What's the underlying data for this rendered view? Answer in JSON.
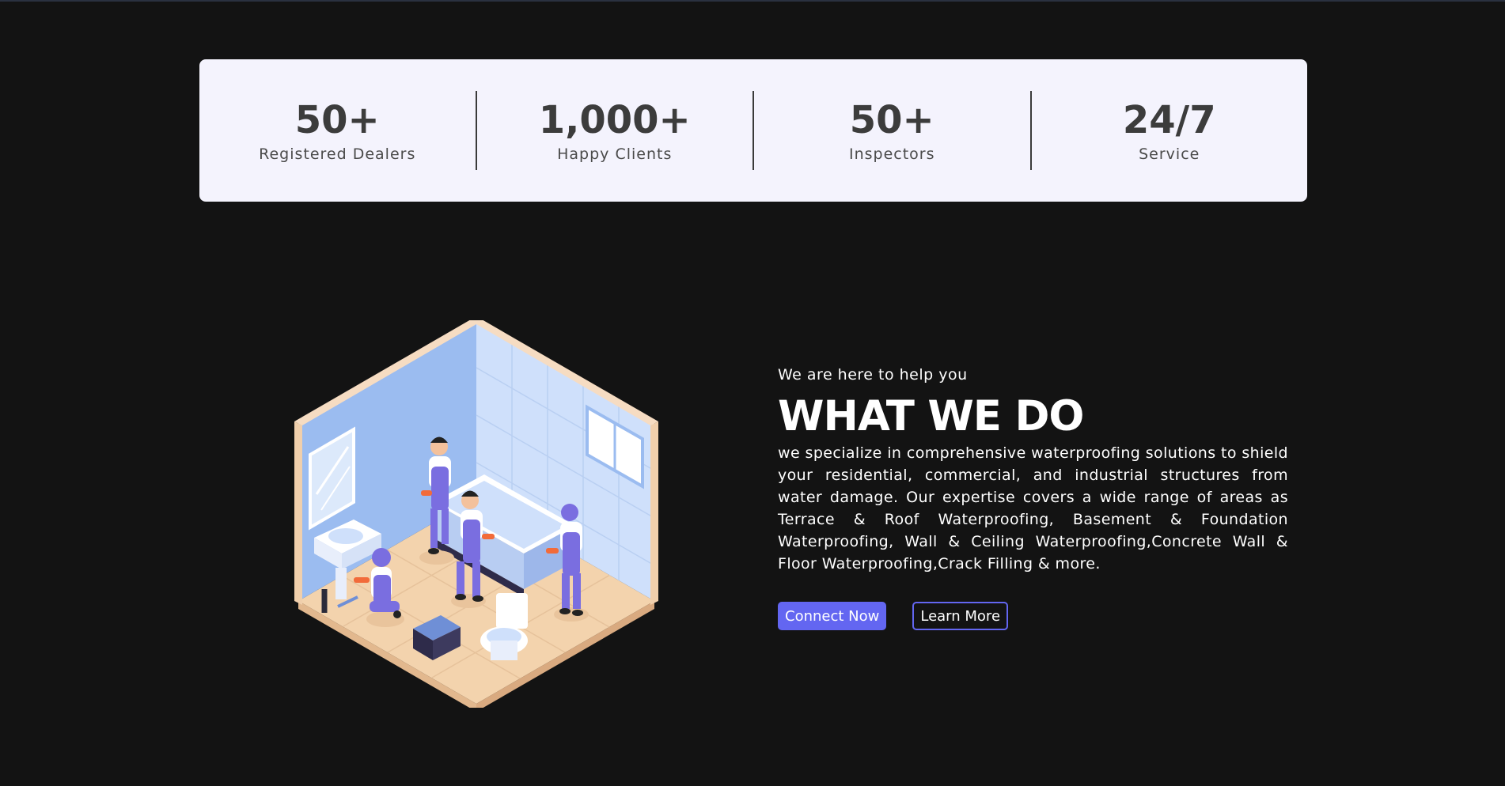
{
  "stats": [
    {
      "value": "50+",
      "label": "Registered Dealers"
    },
    {
      "value": "1,000+",
      "label": "Happy Clients"
    },
    {
      "value": "50+",
      "label": "Inspectors"
    },
    {
      "value": "24/7",
      "label": "Service"
    }
  ],
  "about": {
    "eyebrow": "We are here to help you",
    "heading": "WHAT WE DO",
    "body": "we specialize in comprehensive waterproofing solutions to shield your residential, commercial, and industrial structures from water damage. Our expertise covers a wide range of areas as Terrace & Roof Waterproofing, Basement & Foundation Waterproofing, Wall & Ceiling Waterproofing,Concrete Wall & Floor Waterproofing,Crack Filling & more.",
    "primary_button": "Connect Now",
    "secondary_button": "Learn More"
  },
  "colors": {
    "background": "#131313",
    "card": "#f4f3fd",
    "accent": "#6366f1"
  },
  "icons": {
    "illustration": "bathroom-plumbers-illustration"
  }
}
